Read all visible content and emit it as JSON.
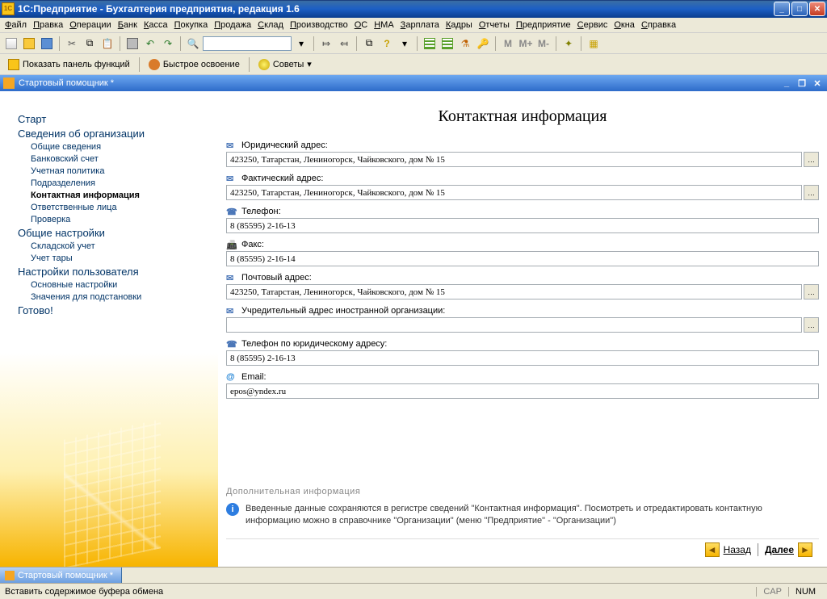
{
  "titlebar": {
    "text": "1С:Предприятие - Бухгалтерия предприятия, редакция 1.6"
  },
  "menubar": [
    "Файл",
    "Правка",
    "Операции",
    "Банк",
    "Касса",
    "Покупка",
    "Продажа",
    "Склад",
    "Производство",
    "ОС",
    "НМА",
    "Зарплата",
    "Кадры",
    "Отчеты",
    "Предприятие",
    "Сервис",
    "Окна",
    "Справка"
  ],
  "toolbar2": {
    "show_panel": "Показать панель функций",
    "quick_learn": "Быстрое освоение",
    "tips": "Советы"
  },
  "subwindow": {
    "title": "Стартовый помощник *"
  },
  "nav": {
    "items": [
      {
        "type": "cat",
        "label": "Старт"
      },
      {
        "type": "cat",
        "label": "Сведения об организации"
      },
      {
        "type": "item",
        "label": "Общие сведения"
      },
      {
        "type": "item",
        "label": "Банковский счет"
      },
      {
        "type": "item",
        "label": "Учетная политика"
      },
      {
        "type": "item",
        "label": "Подразделения"
      },
      {
        "type": "item",
        "label": "Контактная информация",
        "active": true
      },
      {
        "type": "item",
        "label": "Ответственные лица"
      },
      {
        "type": "item",
        "label": "Проверка"
      },
      {
        "type": "cat",
        "label": "Общие настройки"
      },
      {
        "type": "item",
        "label": "Складской учет"
      },
      {
        "type": "item",
        "label": "Учет тары"
      },
      {
        "type": "cat",
        "label": "Настройки пользователя"
      },
      {
        "type": "item",
        "label": "Основные настройки"
      },
      {
        "type": "item",
        "label": "Значения для подстановки"
      },
      {
        "type": "cat",
        "label": "Готово!"
      }
    ]
  },
  "form": {
    "title": "Контактная информация",
    "fields": [
      {
        "icon": "address",
        "label": "Юридический адрес:",
        "value": "423250, Татарстан, Лениногорск, Чайковского, дом № 15",
        "btn": true
      },
      {
        "icon": "address",
        "label": "Фактический адрес:",
        "value": "423250, Татарстан, Лениногорск, Чайковского, дом № 15",
        "btn": true
      },
      {
        "icon": "phone",
        "label": "Телефон:",
        "value": "8 (85595) 2-16-13",
        "btn": false
      },
      {
        "icon": "fax",
        "label": "Факс:",
        "value": "8 (85595) 2-16-14",
        "btn": false
      },
      {
        "icon": "address",
        "label": "Почтовый адрес:",
        "value": "423250, Татарстан, Лениногорск, Чайковского, дом № 15",
        "btn": true
      },
      {
        "icon": "address",
        "label": "Учредительный адрес иностранной организации:",
        "value": "",
        "btn": true
      },
      {
        "icon": "phone",
        "label": "Телефон по юридическому адресу:",
        "value": "8 (85595) 2-16-13",
        "btn": false
      },
      {
        "icon": "email",
        "label": "Email:",
        "value": "epos@yndex.ru",
        "btn": false
      }
    ],
    "addl_header": "Дополнительная информация",
    "addl_text": "Введенные данные сохраняются в регистре сведений \"Контактная информация\". Посмотреть и отредактировать контактную информацию можно в справочнике \"Организации\" (меню \"Предприятие\" - \"Организации\")"
  },
  "footer": {
    "back": "Назад",
    "next": "Далее"
  },
  "taskbar": {
    "tab": "Стартовый помощник *"
  },
  "statusbar": {
    "hint": "Вставить содержимое буфера обмена",
    "cap": "CAP",
    "num": "NUM"
  }
}
